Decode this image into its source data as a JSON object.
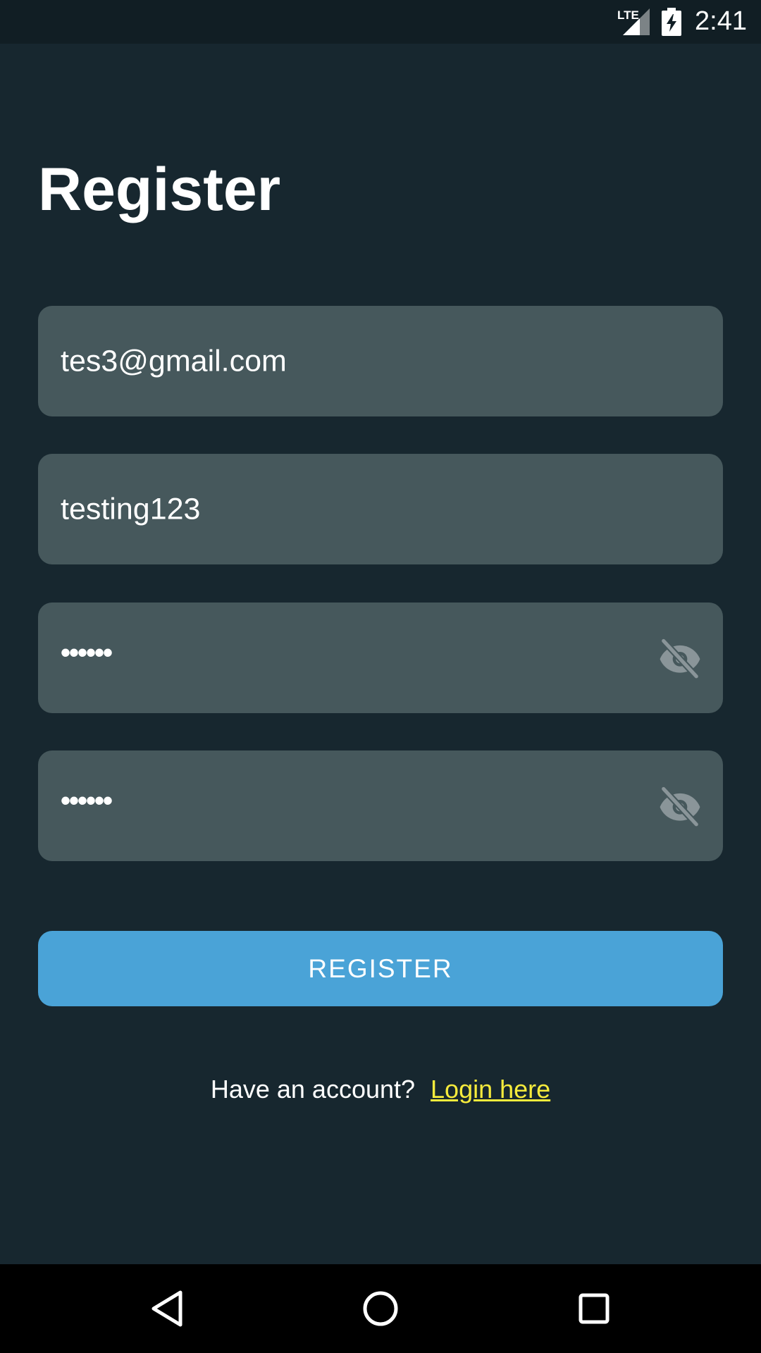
{
  "status_bar": {
    "network": "LTE",
    "time": "2:41",
    "icons": [
      "signal-icon",
      "battery-charging-icon"
    ]
  },
  "page": {
    "title": "Register"
  },
  "form": {
    "email_value": "tes3@gmail.com",
    "username_value": "testing123",
    "password_value": "••••••",
    "confirm_password_value": "••••••",
    "toggle_icon": "eye-off-icon",
    "register_label": "REGISTER"
  },
  "footer": {
    "prompt": "Have an account?",
    "login_link": "Login here"
  },
  "nav_bar": {
    "icons": [
      "back-icon",
      "home-icon",
      "recents-icon"
    ]
  },
  "colors": {
    "background": "#17272f",
    "status_bar": "#111e24",
    "field_bg": "#46585c",
    "accent": "#4aa3d7",
    "link": "#f6eb3c",
    "icon_muted": "#8a9599"
  }
}
